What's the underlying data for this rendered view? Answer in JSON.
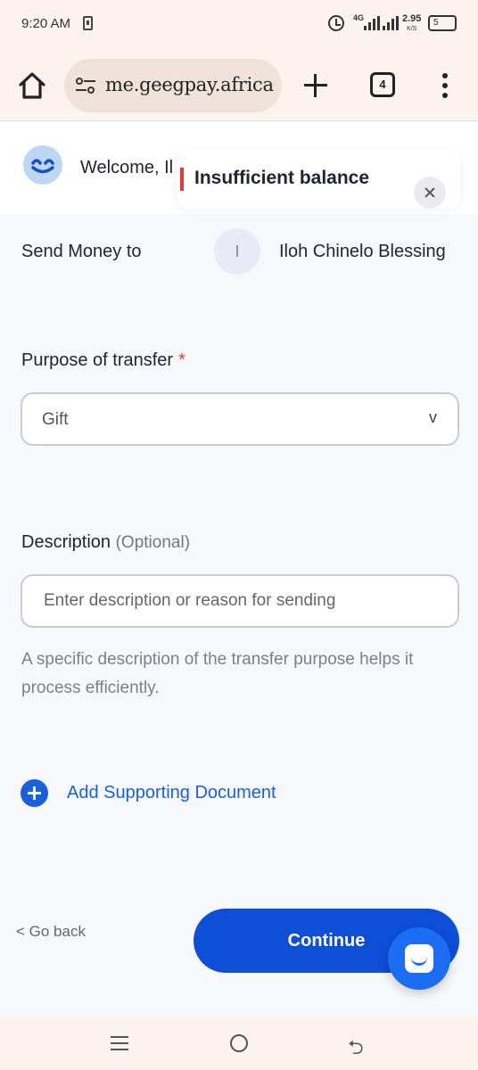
{
  "status_bar": {
    "time": "9:20 AM",
    "network": "4G",
    "speed_value": "2.95",
    "speed_unit": "K/S",
    "battery": "5"
  },
  "browser": {
    "url": "me.geegpay.africa",
    "tab_count": "4"
  },
  "header": {
    "welcome_text": "Welcome, Il"
  },
  "toast": {
    "message": "Insufficient balance",
    "accent_color": "#e53935"
  },
  "send": {
    "label": "Send Money to",
    "avatar_initial": "I",
    "recipient_name": "Iloh Chinelo Blessing"
  },
  "purpose": {
    "label": "Purpose of transfer",
    "required_marker": "*",
    "selected_value": "Gift"
  },
  "description": {
    "label": "Description",
    "optional_tag": "(Optional)",
    "placeholder": "Enter description or reason for sending",
    "value": "",
    "helper_text": "A specific description of the transfer purpose helps it process efficiently."
  },
  "supporting_doc": {
    "label": "Add Supporting Document"
  },
  "actions": {
    "go_back_label": "< Go back",
    "continue_label": "Continue",
    "primary_color": "#0d4fd7"
  }
}
